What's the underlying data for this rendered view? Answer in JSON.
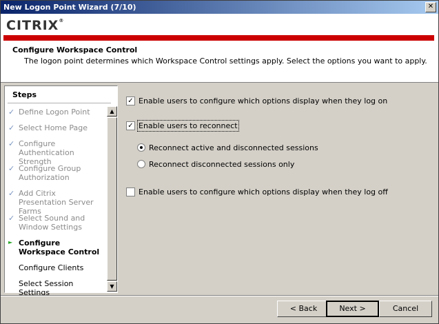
{
  "window": {
    "title": "New Logon Point Wizard (7/10)",
    "close_glyph": "✕"
  },
  "header": {
    "logo": "CITRIX",
    "logo_mark": "®",
    "title": "Configure Workspace Control",
    "description": "The logon point determines which Workspace Control settings apply. Select the options you want to apply."
  },
  "steps": {
    "heading": "Steps",
    "items": [
      {
        "label": "Define Logon Point",
        "state": "done",
        "mark": "✓"
      },
      {
        "label": "Select Home Page",
        "state": "done",
        "mark": "✓"
      },
      {
        "label": "Configure Authentication Strength",
        "state": "done",
        "mark": "✓"
      },
      {
        "label": "Configure Group Authorization",
        "state": "done",
        "mark": "✓"
      },
      {
        "label": "Add Citrix Presentation Server Farms",
        "state": "done",
        "mark": "✓"
      },
      {
        "label": "Select Sound and Window Settings",
        "state": "done",
        "mark": "✓"
      },
      {
        "label": "Configure Workspace Control",
        "state": "current",
        "mark": "►"
      },
      {
        "label": "Configure Clients",
        "state": "todo",
        "mark": ""
      },
      {
        "label": "Select Session Settings",
        "state": "todo",
        "mark": ""
      }
    ],
    "scroll_up": "▲",
    "scroll_down": "▼"
  },
  "options": {
    "configure_logon": {
      "label": "Enable users to configure which options display when they log on",
      "checked": true,
      "glyph": "✓"
    },
    "reconnect": {
      "label": "Enable users to reconnect",
      "checked": true,
      "glyph": "✓"
    },
    "reconnect_active": {
      "label": "Reconnect active and disconnected sessions",
      "selected": true
    },
    "reconnect_disconnected": {
      "label": "Reconnect disconnected sessions only",
      "selected": false
    },
    "configure_logoff": {
      "label": "Enable users to configure which options display when they log off",
      "checked": false
    }
  },
  "buttons": {
    "back": "< Back",
    "next": "Next >",
    "cancel": "Cancel"
  }
}
